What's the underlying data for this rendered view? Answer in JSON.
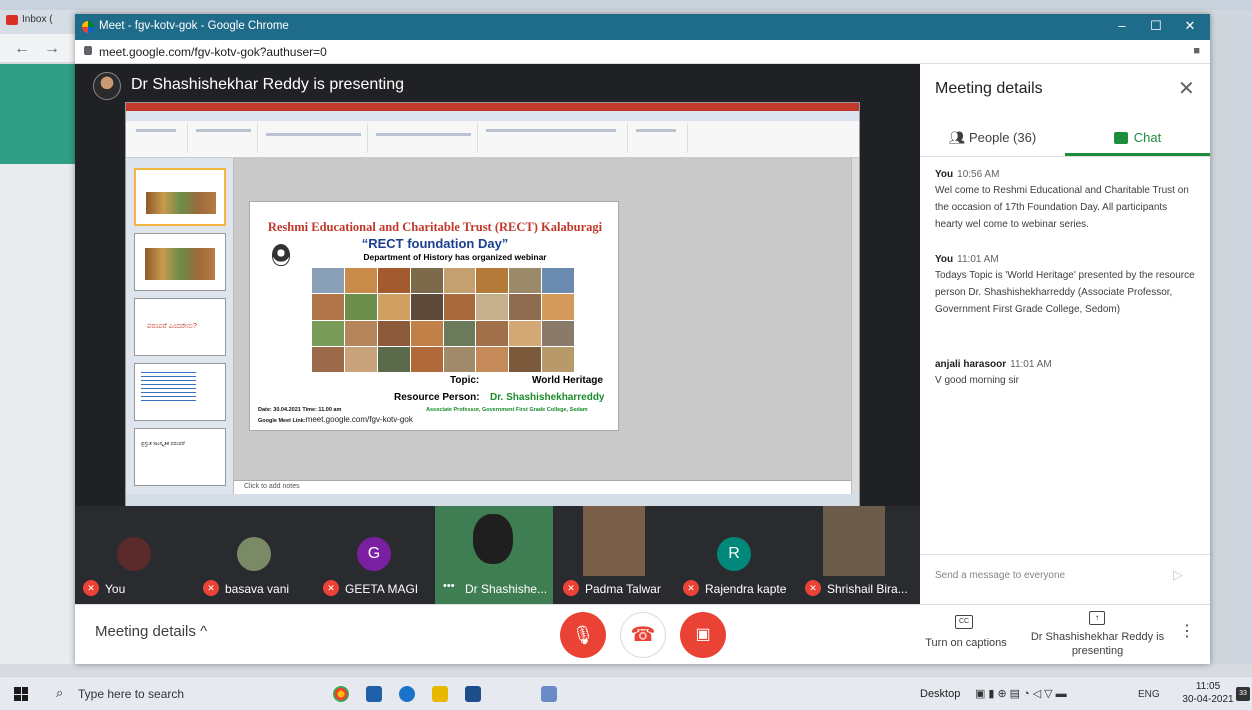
{
  "browser": {
    "background_tab": "Inbox (",
    "window_title": "Meet - fgv-kotv-gok - Google Chrome",
    "url": "meet.google.com/fgv-kotv-gok?authuser=0"
  },
  "stage": {
    "presenting_title": "Dr Shashishekhar Reddy is presenting"
  },
  "ppt": {
    "notes_placeholder": "Click to add notes",
    "thumb3_text": "ಪರಂಪರೆ ಎಂದರೇನು?",
    "thumb5_text": "ಪ್ರಸ್ತುತ ಸಾಂಸ್ಕೃತಿಕ ಪರಂಪರೆ"
  },
  "slide": {
    "org": "Reshmi Educational and Charitable Trust (RECT) Kalaburagi",
    "day": "“RECT foundation Day”",
    "dept": "Department of History  has organized webinar",
    "topic_label": "Topic:",
    "topic_value": "World Heritage",
    "rp_label": "Resource Person:",
    "rp_value": "Dr. Shashishekharreddy",
    "rp_role": "Associate Professor, Government First Grade College, Sedam",
    "date": "Date: 30.04.2021 Time: 11.00 am",
    "link_label": "Google Meet Link:",
    "link": "meet.google.com/fgv-kotv-gok"
  },
  "participants": [
    {
      "name": "You",
      "initial": "",
      "color": "#5b2a2a"
    },
    {
      "name": "basava vani",
      "initial": "",
      "color": "#7a8a66"
    },
    {
      "name": "GEETA MAGI",
      "initial": "G",
      "color": "#7b1fa2"
    },
    {
      "name": "Dr Shashishe...",
      "initial": "",
      "color": "#4b8b5a"
    },
    {
      "name": "Padma Talwar",
      "initial": "",
      "color": "#6e5a4a"
    },
    {
      "name": "Rajendra kapte",
      "initial": "R",
      "color": "#00897b"
    },
    {
      "name": "Shrishail Bira...",
      "initial": "",
      "color": "#6b5b4a"
    }
  ],
  "bottom": {
    "meeting_details": "Meeting details",
    "captions": "Turn on captions",
    "presenting": "Dr Shashishekhar Reddy is presenting"
  },
  "panel": {
    "title": "Meeting details",
    "people_tab": "People (36)",
    "chat_tab": "Chat",
    "messages": [
      {
        "sender": "You",
        "time": "10:56 AM",
        "text": "Wel come to Reshmi Educational and Charitable Trust on the occasion of 17th Foundation Day. All participants hearty wel come to webinar series."
      },
      {
        "sender": "You",
        "time": "11:01 AM",
        "text": "Todays Topic is 'World Heritage' presented by the resource person Dr. Shashishekharreddy (Associate Professor, Government First Grade College, Sedom)"
      },
      {
        "sender": "anjali harasoor",
        "time": "11:01 AM",
        "text": "V good morning sir"
      }
    ],
    "send_placeholder": "Send a message to everyone"
  },
  "taskbar": {
    "search_placeholder": "Type here to search",
    "desktop": "Desktop",
    "lang": "ENG",
    "time": "11:05",
    "date": "30-04-2021",
    "notifications": "33"
  },
  "colors": {
    "meet_red": "#ea4335",
    "chat_green": "#1e8e3e",
    "title_bar": "#1e6b8a"
  }
}
